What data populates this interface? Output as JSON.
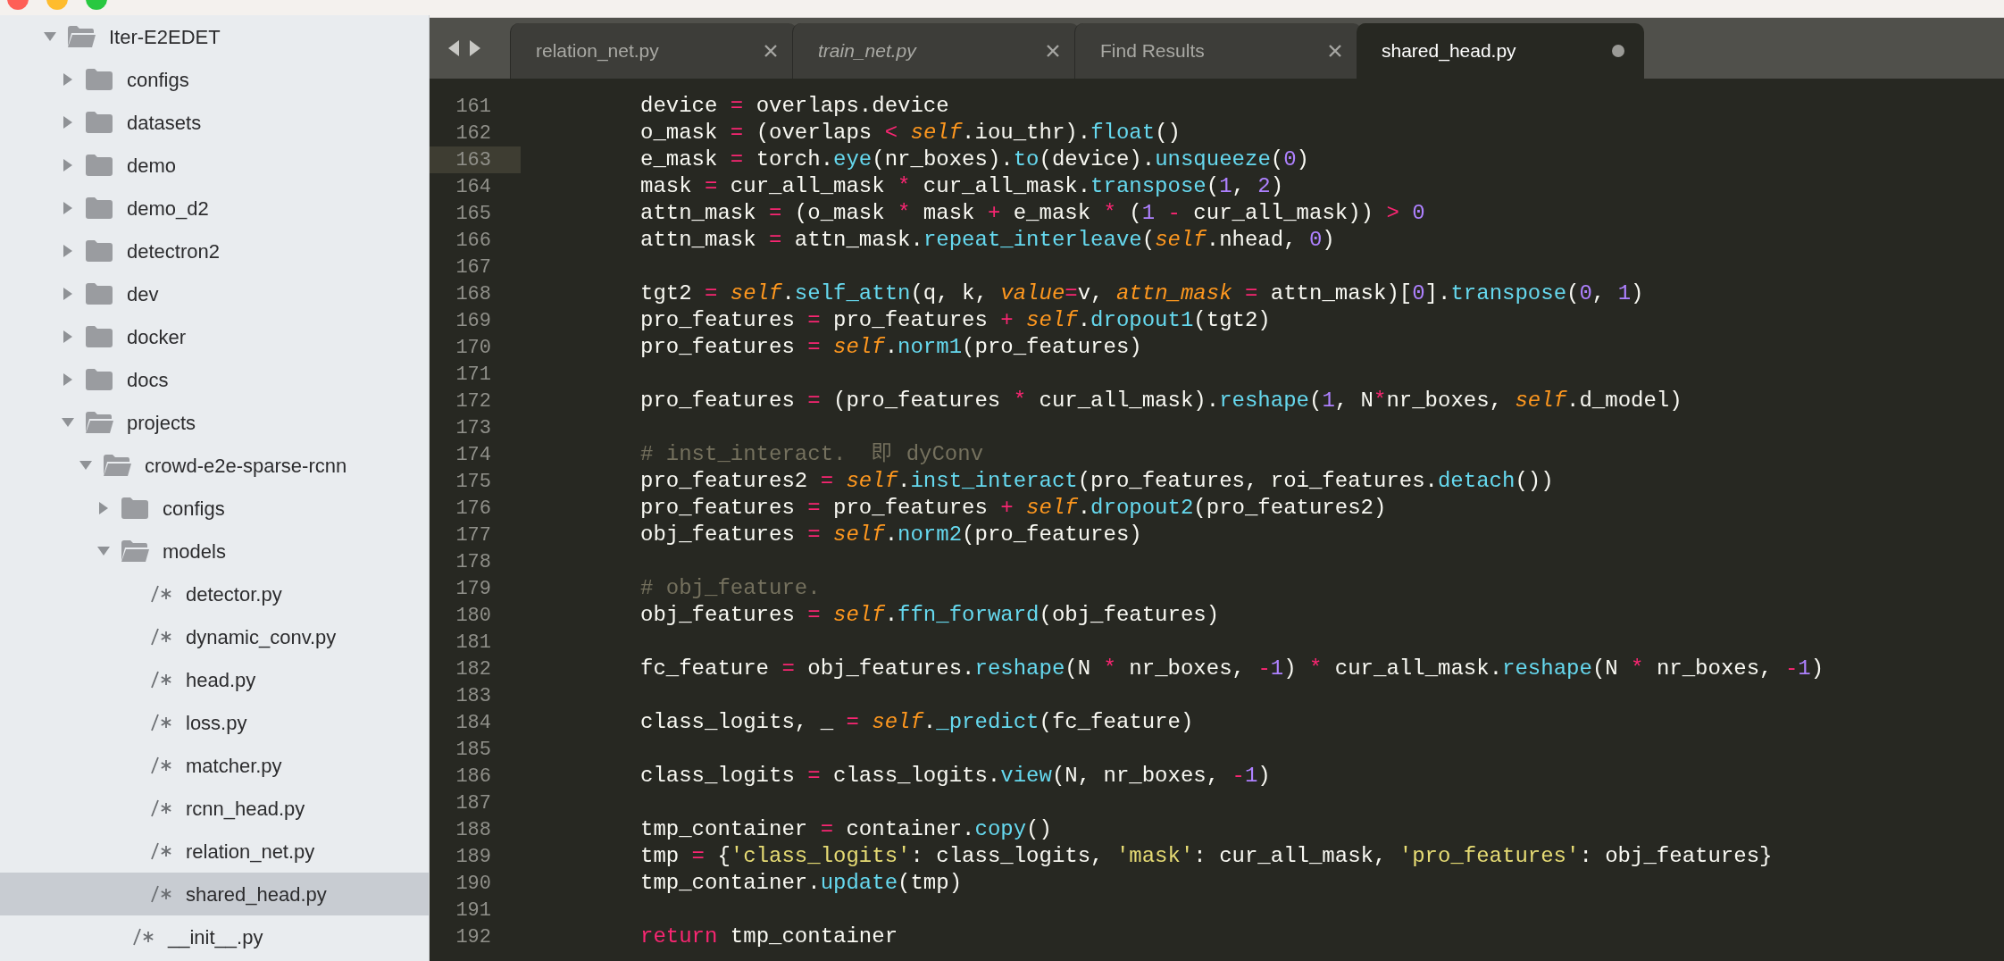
{
  "sidebar": {
    "tree": [
      {
        "name": "Iter-E2EDET",
        "kind": "folder",
        "expanded": true,
        "selected": false,
        "children": [
          {
            "name": "configs",
            "kind": "folder",
            "expanded": false,
            "selected": false
          },
          {
            "name": "datasets",
            "kind": "folder",
            "expanded": false,
            "selected": false
          },
          {
            "name": "demo",
            "kind": "folder",
            "expanded": false,
            "selected": false
          },
          {
            "name": "demo_d2",
            "kind": "folder",
            "expanded": false,
            "selected": false
          },
          {
            "name": "detectron2",
            "kind": "folder",
            "expanded": false,
            "selected": false
          },
          {
            "name": "dev",
            "kind": "folder",
            "expanded": false,
            "selected": false
          },
          {
            "name": "docker",
            "kind": "folder",
            "expanded": false,
            "selected": false
          },
          {
            "name": "docs",
            "kind": "folder",
            "expanded": false,
            "selected": false
          },
          {
            "name": "projects",
            "kind": "folder",
            "expanded": true,
            "selected": false,
            "children": [
              {
                "name": "crowd-e2e-sparse-rcnn",
                "kind": "folder",
                "expanded": true,
                "selected": false,
                "children": [
                  {
                    "name": "configs",
                    "kind": "folder",
                    "expanded": false,
                    "selected": false
                  },
                  {
                    "name": "models",
                    "kind": "folder",
                    "expanded": true,
                    "selected": false,
                    "children": [
                      {
                        "name": "detector.py",
                        "kind": "file",
                        "selected": false
                      },
                      {
                        "name": "dynamic_conv.py",
                        "kind": "file",
                        "selected": false
                      },
                      {
                        "name": "head.py",
                        "kind": "file",
                        "selected": false
                      },
                      {
                        "name": "loss.py",
                        "kind": "file",
                        "selected": false
                      },
                      {
                        "name": "matcher.py",
                        "kind": "file",
                        "selected": false
                      },
                      {
                        "name": "rcnn_head.py",
                        "kind": "file",
                        "selected": false
                      },
                      {
                        "name": "relation_net.py",
                        "kind": "file",
                        "selected": false
                      },
                      {
                        "name": "shared_head.py",
                        "kind": "file",
                        "selected": true
                      }
                    ]
                  },
                  {
                    "name": "__init__.py",
                    "kind": "file",
                    "selected": false
                  }
                ]
              }
            ]
          }
        ]
      }
    ]
  },
  "tabs": [
    {
      "label": "relation_net.py",
      "selected": false,
      "transient": false,
      "modified": false
    },
    {
      "label": "train_net.py",
      "selected": false,
      "transient": true,
      "modified": false
    },
    {
      "label": "Find Results",
      "selected": false,
      "transient": false,
      "modified": false
    },
    {
      "label": "shared_head.py",
      "selected": true,
      "transient": false,
      "modified": true
    }
  ],
  "editor": {
    "lines": [
      {
        "number": "161",
        "current": false,
        "tokens": [
          {
            "text": "device ",
            "kind": "plain"
          },
          {
            "text": "=",
            "kind": "operator"
          },
          {
            "text": " overlaps.device",
            "kind": "plain"
          }
        ]
      },
      {
        "number": "162",
        "current": false,
        "tokens": [
          {
            "text": "o_mask ",
            "kind": "plain"
          },
          {
            "text": "=",
            "kind": "operator"
          },
          {
            "text": " (overlaps ",
            "kind": "plain"
          },
          {
            "text": "< ",
            "kind": "operator"
          },
          {
            "text": "self",
            "kind": "self"
          },
          {
            "text": ".iou_thr).",
            "kind": "plain"
          },
          {
            "text": "float",
            "kind": "call"
          },
          {
            "text": "()",
            "kind": "plain"
          }
        ]
      },
      {
        "number": "163",
        "current": true,
        "tokens": [
          {
            "text": "e_mask ",
            "kind": "plain"
          },
          {
            "text": "=",
            "kind": "operator"
          },
          {
            "text": " torch.",
            "kind": "plain"
          },
          {
            "text": "eye",
            "kind": "call"
          },
          {
            "text": "(nr_boxes).",
            "kind": "plain"
          },
          {
            "text": "to",
            "kind": "call"
          },
          {
            "text": "(device).",
            "kind": "plain"
          },
          {
            "text": "unsqueeze",
            "kind": "call"
          },
          {
            "text": "(",
            "kind": "plain"
          },
          {
            "text": "0",
            "kind": "number"
          },
          {
            "text": ")",
            "kind": "plain"
          }
        ]
      },
      {
        "number": "164",
        "current": false,
        "tokens": [
          {
            "text": "mask ",
            "kind": "plain"
          },
          {
            "text": "=",
            "kind": "operator"
          },
          {
            "text": " cur_all_mask ",
            "kind": "plain"
          },
          {
            "text": "*",
            "kind": "operator"
          },
          {
            "text": " cur_all_mask.",
            "kind": "plain"
          },
          {
            "text": "transpose",
            "kind": "call"
          },
          {
            "text": "(",
            "kind": "plain"
          },
          {
            "text": "1",
            "kind": "number"
          },
          {
            "text": ", ",
            "kind": "plain"
          },
          {
            "text": "2",
            "kind": "number"
          },
          {
            "text": ")",
            "kind": "plain"
          }
        ]
      },
      {
        "number": "165",
        "current": false,
        "tokens": [
          {
            "text": "attn_mask ",
            "kind": "plain"
          },
          {
            "text": "=",
            "kind": "operator"
          },
          {
            "text": " (o_mask ",
            "kind": "plain"
          },
          {
            "text": "*",
            "kind": "operator"
          },
          {
            "text": " mask ",
            "kind": "plain"
          },
          {
            "text": "+",
            "kind": "operator"
          },
          {
            "text": " e_mask ",
            "kind": "plain"
          },
          {
            "text": "*",
            "kind": "operator"
          },
          {
            "text": " (",
            "kind": "plain"
          },
          {
            "text": "1",
            "kind": "number"
          },
          {
            "text": " - ",
            "kind": "operator"
          },
          {
            "text": "cur_all_mask)) ",
            "kind": "plain"
          },
          {
            "text": "> ",
            "kind": "operator"
          },
          {
            "text": "0",
            "kind": "number"
          }
        ]
      },
      {
        "number": "166",
        "current": false,
        "tokens": [
          {
            "text": "attn_mask ",
            "kind": "plain"
          },
          {
            "text": "=",
            "kind": "operator"
          },
          {
            "text": " attn_mask.",
            "kind": "plain"
          },
          {
            "text": "repeat_interleave",
            "kind": "call"
          },
          {
            "text": "(",
            "kind": "plain"
          },
          {
            "text": "self",
            "kind": "self"
          },
          {
            "text": ".nhead, ",
            "kind": "plain"
          },
          {
            "text": "0",
            "kind": "number"
          },
          {
            "text": ")",
            "kind": "plain"
          }
        ]
      },
      {
        "number": "167",
        "current": false
      },
      {
        "number": "168",
        "current": false,
        "tokens": [
          {
            "text": "tgt2 ",
            "kind": "plain"
          },
          {
            "text": "= ",
            "kind": "operator"
          },
          {
            "text": "self",
            "kind": "self"
          },
          {
            "text": ".",
            "kind": "plain"
          },
          {
            "text": "self_attn",
            "kind": "call"
          },
          {
            "text": "(q, k, ",
            "kind": "plain"
          },
          {
            "text": "value",
            "kind": "argument"
          },
          {
            "text": "=",
            "kind": "operator"
          },
          {
            "text": "v, ",
            "kind": "plain"
          },
          {
            "text": "attn_mask",
            "kind": "argument"
          },
          {
            "text": " =",
            "kind": "operator"
          },
          {
            "text": " attn_mask)[",
            "kind": "plain"
          },
          {
            "text": "0",
            "kind": "number"
          },
          {
            "text": "].",
            "kind": "plain"
          },
          {
            "text": "transpose",
            "kind": "call"
          },
          {
            "text": "(",
            "kind": "plain"
          },
          {
            "text": "0",
            "kind": "number"
          },
          {
            "text": ", ",
            "kind": "plain"
          },
          {
            "text": "1",
            "kind": "number"
          },
          {
            "text": ")",
            "kind": "plain"
          }
        ]
      },
      {
        "number": "169",
        "current": false,
        "tokens": [
          {
            "text": "pro_features ",
            "kind": "plain"
          },
          {
            "text": "=",
            "kind": "operator"
          },
          {
            "text": " pro_features ",
            "kind": "plain"
          },
          {
            "text": "+ ",
            "kind": "operator"
          },
          {
            "text": "self",
            "kind": "self"
          },
          {
            "text": ".",
            "kind": "plain"
          },
          {
            "text": "dropout1",
            "kind": "call"
          },
          {
            "text": "(tgt2)",
            "kind": "plain"
          }
        ]
      },
      {
        "number": "170",
        "current": false,
        "tokens": [
          {
            "text": "pro_features ",
            "kind": "plain"
          },
          {
            "text": "= ",
            "kind": "operator"
          },
          {
            "text": "self",
            "kind": "self"
          },
          {
            "text": ".",
            "kind": "plain"
          },
          {
            "text": "norm1",
            "kind": "call"
          },
          {
            "text": "(pro_features)",
            "kind": "plain"
          }
        ]
      },
      {
        "number": "171",
        "current": false
      },
      {
        "number": "172",
        "current": false,
        "tokens": [
          {
            "text": "pro_features ",
            "kind": "plain"
          },
          {
            "text": "=",
            "kind": "operator"
          },
          {
            "text": " (pro_features ",
            "kind": "plain"
          },
          {
            "text": "*",
            "kind": "operator"
          },
          {
            "text": " cur_all_mask).",
            "kind": "plain"
          },
          {
            "text": "reshape",
            "kind": "call"
          },
          {
            "text": "(",
            "kind": "plain"
          },
          {
            "text": "1",
            "kind": "number"
          },
          {
            "text": ", N",
            "kind": "plain"
          },
          {
            "text": "*",
            "kind": "operator"
          },
          {
            "text": "nr_boxes, ",
            "kind": "plain"
          },
          {
            "text": "self",
            "kind": "self"
          },
          {
            "text": ".d_model)",
            "kind": "plain"
          }
        ]
      },
      {
        "number": "173",
        "current": false
      },
      {
        "number": "174",
        "current": false,
        "tokens": [
          {
            "text": "# inst_interact.  即 dyConv",
            "kind": "comment"
          }
        ]
      },
      {
        "number": "175",
        "current": false,
        "tokens": [
          {
            "text": "pro_features2 ",
            "kind": "plain"
          },
          {
            "text": "= ",
            "kind": "operator"
          },
          {
            "text": "self",
            "kind": "self"
          },
          {
            "text": ".",
            "kind": "plain"
          },
          {
            "text": "inst_interact",
            "kind": "call"
          },
          {
            "text": "(pro_features, roi_features.",
            "kind": "plain"
          },
          {
            "text": "detach",
            "kind": "call"
          },
          {
            "text": "())",
            "kind": "plain"
          }
        ]
      },
      {
        "number": "176",
        "current": false,
        "tokens": [
          {
            "text": "pro_features ",
            "kind": "plain"
          },
          {
            "text": "=",
            "kind": "operator"
          },
          {
            "text": " pro_features ",
            "kind": "plain"
          },
          {
            "text": "+ ",
            "kind": "operator"
          },
          {
            "text": "self",
            "kind": "self"
          },
          {
            "text": ".",
            "kind": "plain"
          },
          {
            "text": "dropout2",
            "kind": "call"
          },
          {
            "text": "(pro_features2)",
            "kind": "plain"
          }
        ]
      },
      {
        "number": "177",
        "current": false,
        "tokens": [
          {
            "text": "obj_features ",
            "kind": "plain"
          },
          {
            "text": "= ",
            "kind": "operator"
          },
          {
            "text": "self",
            "kind": "self"
          },
          {
            "text": ".",
            "kind": "plain"
          },
          {
            "text": "norm2",
            "kind": "call"
          },
          {
            "text": "(pro_features)",
            "kind": "plain"
          }
        ]
      },
      {
        "number": "178",
        "current": false
      },
      {
        "number": "179",
        "current": false,
        "tokens": [
          {
            "text": "# obj_feature.",
            "kind": "comment"
          }
        ]
      },
      {
        "number": "180",
        "current": false,
        "tokens": [
          {
            "text": "obj_features ",
            "kind": "plain"
          },
          {
            "text": "= ",
            "kind": "operator"
          },
          {
            "text": "self",
            "kind": "self"
          },
          {
            "text": ".",
            "kind": "plain"
          },
          {
            "text": "ffn_forward",
            "kind": "call"
          },
          {
            "text": "(obj_features)",
            "kind": "plain"
          }
        ]
      },
      {
        "number": "181",
        "current": false
      },
      {
        "number": "182",
        "current": false,
        "tokens": [
          {
            "text": "fc_feature ",
            "kind": "plain"
          },
          {
            "text": "=",
            "kind": "operator"
          },
          {
            "text": " obj_features.",
            "kind": "plain"
          },
          {
            "text": "reshape",
            "kind": "call"
          },
          {
            "text": "(N ",
            "kind": "plain"
          },
          {
            "text": "*",
            "kind": "operator"
          },
          {
            "text": " nr_boxes, ",
            "kind": "plain"
          },
          {
            "text": "-",
            "kind": "operator"
          },
          {
            "text": "1",
            "kind": "number"
          },
          {
            "text": ") ",
            "kind": "plain"
          },
          {
            "text": "*",
            "kind": "operator"
          },
          {
            "text": " cur_all_mask.",
            "kind": "plain"
          },
          {
            "text": "reshape",
            "kind": "call"
          },
          {
            "text": "(N ",
            "kind": "plain"
          },
          {
            "text": "*",
            "kind": "operator"
          },
          {
            "text": " nr_boxes, ",
            "kind": "plain"
          },
          {
            "text": "-",
            "kind": "operator"
          },
          {
            "text": "1",
            "kind": "number"
          },
          {
            "text": ")",
            "kind": "plain"
          }
        ]
      },
      {
        "number": "183",
        "current": false
      },
      {
        "number": "184",
        "current": false,
        "tokens": [
          {
            "text": "class_logits, _ ",
            "kind": "plain"
          },
          {
            "text": "= ",
            "kind": "operator"
          },
          {
            "text": "self",
            "kind": "self"
          },
          {
            "text": ".",
            "kind": "plain"
          },
          {
            "text": "_predict",
            "kind": "call"
          },
          {
            "text": "(fc_feature)",
            "kind": "plain"
          }
        ]
      },
      {
        "number": "185",
        "current": false
      },
      {
        "number": "186",
        "current": false,
        "tokens": [
          {
            "text": "class_logits ",
            "kind": "plain"
          },
          {
            "text": "=",
            "kind": "operator"
          },
          {
            "text": " class_logits.",
            "kind": "plain"
          },
          {
            "text": "view",
            "kind": "call"
          },
          {
            "text": "(N, nr_boxes, ",
            "kind": "plain"
          },
          {
            "text": "-",
            "kind": "operator"
          },
          {
            "text": "1",
            "kind": "number"
          },
          {
            "text": ")",
            "kind": "plain"
          }
        ]
      },
      {
        "number": "187",
        "current": false
      },
      {
        "number": "188",
        "current": false,
        "tokens": [
          {
            "text": "tmp_container ",
            "kind": "plain"
          },
          {
            "text": "=",
            "kind": "operator"
          },
          {
            "text": " container.",
            "kind": "plain"
          },
          {
            "text": "copy",
            "kind": "call"
          },
          {
            "text": "()",
            "kind": "plain"
          }
        ]
      },
      {
        "number": "189",
        "current": false,
        "tokens": [
          {
            "text": "tmp ",
            "kind": "plain"
          },
          {
            "text": "=",
            "kind": "operator"
          },
          {
            "text": " {",
            "kind": "plain"
          },
          {
            "text": "'class_logits'",
            "kind": "string"
          },
          {
            "text": ": class_logits, ",
            "kind": "plain"
          },
          {
            "text": "'mask'",
            "kind": "string"
          },
          {
            "text": ": cur_all_mask, ",
            "kind": "plain"
          },
          {
            "text": "'pro_features'",
            "kind": "string"
          },
          {
            "text": ": obj_features}",
            "kind": "plain"
          }
        ]
      },
      {
        "number": "190",
        "current": false,
        "tokens": [
          {
            "text": "tmp_container.",
            "kind": "plain"
          },
          {
            "text": "update",
            "kind": "call"
          },
          {
            "text": "(tmp)",
            "kind": "plain"
          }
        ]
      },
      {
        "number": "191",
        "current": false
      },
      {
        "number": "192",
        "current": false,
        "tokens": [
          {
            "text": "return",
            "kind": "keyword"
          },
          {
            "text": " tmp_container",
            "kind": "plain"
          }
        ]
      }
    ]
  }
}
